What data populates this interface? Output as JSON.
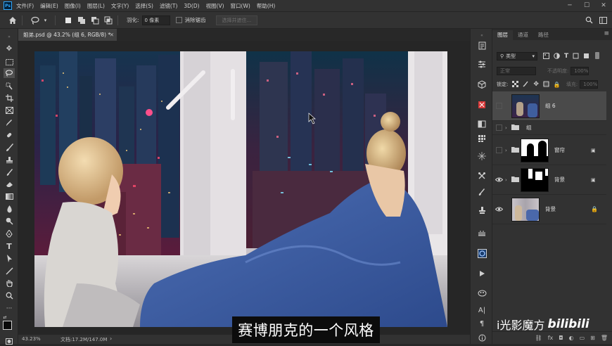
{
  "menubar": {
    "app_logo": "Ps",
    "items": [
      "文件(F)",
      "编辑(E)",
      "图像(I)",
      "图层(L)",
      "文字(Y)",
      "选择(S)",
      "滤镜(T)",
      "3D(D)",
      "视图(V)",
      "窗口(W)",
      "帮助(H)"
    ],
    "controls": [
      "minimize-icon",
      "maximize-icon",
      "close-icon"
    ]
  },
  "optionsbar": {
    "feather_label": "羽化:",
    "feather_value": "0 像素",
    "antialias_label": "消除锯齿",
    "select_subject_label": "选择并遮住..."
  },
  "document": {
    "tab_title": "姐弟.psd @ 43.2% (组 6, RGB/8) *",
    "zoom": "43.23%",
    "doc_size": "文档:17.2M/147.0M"
  },
  "subtitle": "赛博朋克的一个风格",
  "layers_panel": {
    "tabs": [
      "图层",
      "通道",
      "路径"
    ],
    "active_tab": "图层",
    "filter_kind": "类型",
    "blend_mode": "正常",
    "opacity_label": "不透明度:",
    "opacity_value": "100%",
    "lock_label": "锁定:",
    "fill_label": "填充:",
    "fill_value": "100%",
    "layers": [
      {
        "name": "组 6",
        "visible": false,
        "type": "group-thumb",
        "selected": true
      },
      {
        "name": "组",
        "visible": false,
        "type": "group"
      },
      {
        "name": "窗帘",
        "visible": false,
        "type": "group-mask"
      },
      {
        "name": "背景",
        "visible": true,
        "type": "group-mask"
      },
      {
        "name": "背景",
        "visible": true,
        "type": "background"
      }
    ]
  },
  "watermark": {
    "text": "i光影魔方",
    "logo": "bilibili"
  },
  "colors": {
    "ui_dark": "#323232",
    "canvas_bg": "#262626",
    "accent": "#31a8ff",
    "selected_layer": "#4a4a4a"
  }
}
